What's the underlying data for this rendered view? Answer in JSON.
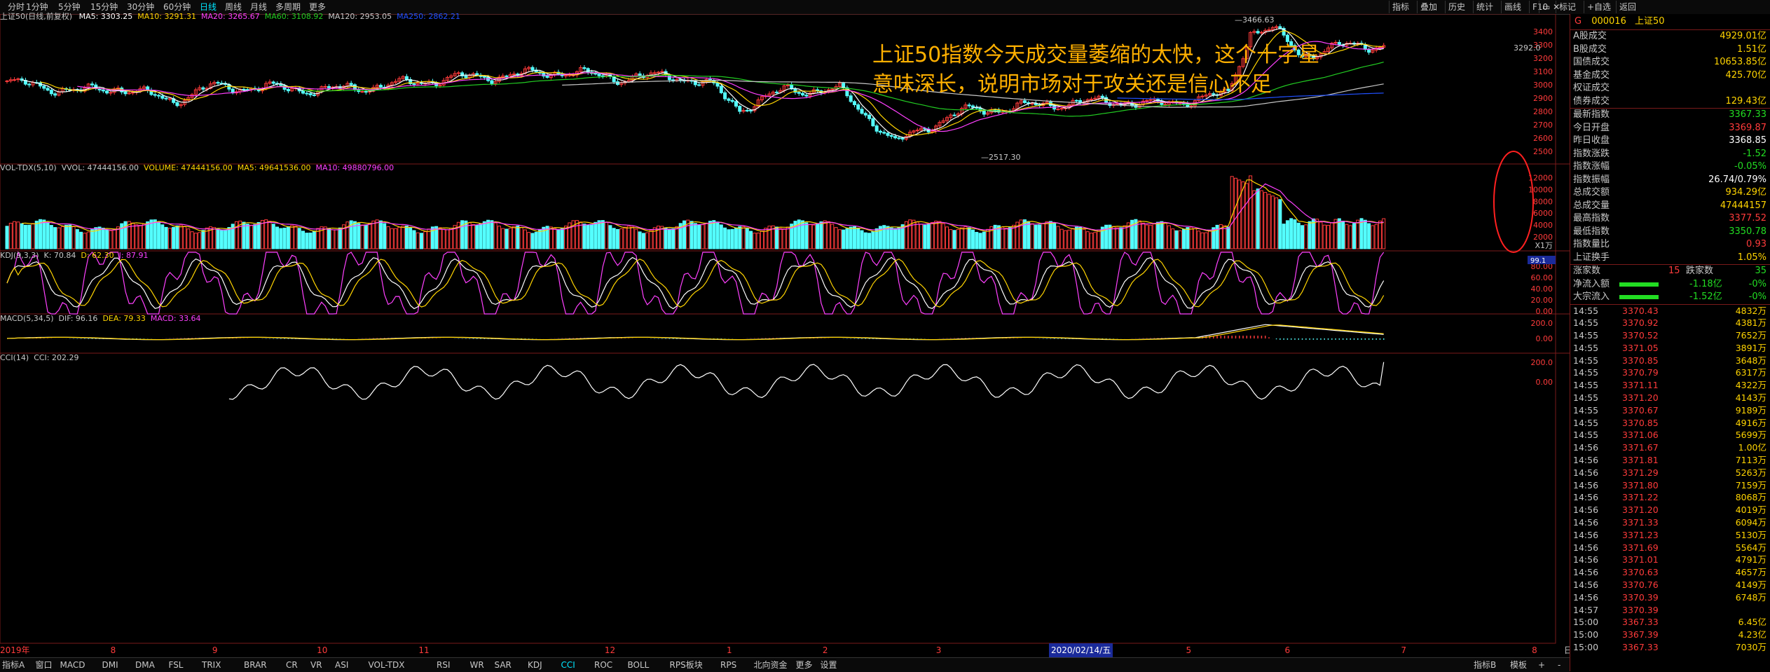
{
  "topbar": {
    "periods": [
      "分时",
      "1分钟",
      "5分钟",
      "15分钟",
      "30分钟",
      "60分钟",
      "日线",
      "周线",
      "月线",
      "多周期",
      "更多"
    ],
    "active_period": "日线",
    "tools": [
      "指标",
      "叠加",
      "历史",
      "统计",
      "画线",
      "F10",
      "标记",
      "+自选",
      "返回"
    ]
  },
  "main_panel": {
    "title": "上证50(日线,前复权)",
    "ma_labels": [
      {
        "text": "MA5: 3303.25",
        "color": "#ffffff"
      },
      {
        "text": "MA10: 3291.31",
        "color": "#ffd400"
      },
      {
        "text": "MA20: 3265.67",
        "color": "#ff40ff"
      },
      {
        "text": "MA60: 3108.92",
        "color": "#22cc22"
      },
      {
        "text": "MA120: 2953.05",
        "color": "#c8c8c8"
      },
      {
        "text": "MA250: 2862.21",
        "color": "#2050ff"
      }
    ],
    "y_ticks": [
      "3400",
      "3300",
      "3200",
      "3100",
      "3000",
      "2900",
      "2800",
      "2700",
      "2600",
      "2500"
    ],
    "high_label": "3466.63",
    "low_label": "2517.30",
    "last_label": "3292.0",
    "annotation_lines": [
      "上证50指数今天成交量萎缩的太快，这个十字星",
      "意味深长，说明市场对于攻关还是信心不足"
    ]
  },
  "volume_panel": {
    "labels": [
      {
        "text": "VOL-TDX(5,10)",
        "color": "#c8c8c8"
      },
      {
        "text": "VVOL: 47444156.00",
        "color": "#c8c8c8"
      },
      {
        "text": "VOLUME: 47444156.00",
        "color": "#ffd400"
      },
      {
        "text": "MA5: 49641536.00",
        "color": "#ffd400"
      },
      {
        "text": "MA10: 49880796.00",
        "color": "#ff40ff"
      }
    ],
    "y_ticks": [
      "12000",
      "10000",
      "8000",
      "6000",
      "4000",
      "2000"
    ],
    "unit": "X1万"
  },
  "kdj_panel": {
    "labels": [
      {
        "text": "KDJ(9,3,3)",
        "color": "#c8c8c8"
      },
      {
        "text": "K: 70.84",
        "color": "#c8c8c8"
      },
      {
        "text": "D: 62.30",
        "color": "#ffd400"
      },
      {
        "text": "J: 87.91",
        "color": "#ff40ff"
      }
    ],
    "y_ticks": [
      "80.00",
      "60.00",
      "40.00",
      "20.00",
      "0.00"
    ],
    "marker": "99.1"
  },
  "macd_panel": {
    "labels": [
      {
        "text": "MACD(5,34,5)",
        "color": "#c8c8c8"
      },
      {
        "text": "DIF: 96.16",
        "color": "#c8c8c8"
      },
      {
        "text": "DEA: 79.33",
        "color": "#ffd400"
      },
      {
        "text": "MACD: 33.64",
        "color": "#ff40ff"
      }
    ],
    "y_ticks": [
      "200.0",
      "0.00"
    ]
  },
  "cci_panel": {
    "labels": [
      {
        "text": "CCI(14)",
        "color": "#c8c8c8"
      },
      {
        "text": "CCI: 202.29",
        "color": "#c8c8c8"
      }
    ],
    "y_ticks": [
      "200.0",
      "0.00"
    ]
  },
  "date_axis": {
    "labels": [
      "2019年",
      "8",
      "9",
      "10",
      "11",
      "12",
      "1",
      "2",
      "3",
      "4",
      "5",
      "6",
      "7",
      "8"
    ],
    "highlight": "2020/02/14/五",
    "period_label": "日线"
  },
  "bottombar": {
    "tabs": [
      "指标A",
      "窗口",
      "MACD",
      "DMI",
      "DMA",
      "FSL",
      "TRIX",
      "BRAR",
      "CR",
      "VR",
      "ASI",
      "VOL-TDX",
      "RSI",
      "WR",
      "SAR",
      "KDJ",
      "CCI",
      "ROC",
      "BOLL",
      "RPS板块",
      "RPS",
      "北向资金",
      "更多",
      "设置"
    ],
    "active_tab": "CCI",
    "right_items": [
      "指标B",
      "模板",
      "+",
      "-"
    ]
  },
  "right_panel": {
    "code": "000016",
    "name": "上证50",
    "rows": [
      {
        "k": "A股成交",
        "v": "4929.01亿",
        "color": "#ffd400"
      },
      {
        "k": "B股成交",
        "v": "1.51亿",
        "color": "#ffd400"
      },
      {
        "k": "国债成交",
        "v": "10653.85亿",
        "color": "#ffd400"
      },
      {
        "k": "基金成交",
        "v": "425.70亿",
        "color": "#ffd400"
      },
      {
        "k": "权证成交",
        "v": "",
        "color": "#ffd400"
      },
      {
        "k": "债券成交",
        "v": "129.43亿",
        "color": "#ffd400"
      },
      {
        "k": "最新指数",
        "v": "3367.33",
        "color": "#22dd22"
      },
      {
        "k": "今日开盘",
        "v": "3369.87",
        "color": "#ff3b3b"
      },
      {
        "k": "昨日收盘",
        "v": "3368.85",
        "color": "#ffffff"
      },
      {
        "k": "指数涨跌",
        "v": "-1.52",
        "color": "#22dd22"
      },
      {
        "k": "指数涨幅",
        "v": "-0.05%",
        "color": "#22dd22"
      },
      {
        "k": "指数振幅",
        "v": "26.74/0.79%",
        "color": "#ffffff"
      },
      {
        "k": "总成交额",
        "v": "934.29亿",
        "color": "#ffd400"
      },
      {
        "k": "总成交量",
        "v": "47444157",
        "color": "#ffd400"
      },
      {
        "k": "最高指数",
        "v": "3377.52",
        "color": "#ff3b3b"
      },
      {
        "k": "最低指数",
        "v": "3350.78",
        "color": "#22dd22"
      },
      {
        "k": "指数量比",
        "v": "0.93",
        "color": "#ff3b3b"
      },
      {
        "k": "上证换手",
        "v": "1.05%",
        "color": "#ffd400"
      }
    ],
    "up_label": "涨家数",
    "up_count": "15",
    "down_label": "跌家数",
    "down_count": "35",
    "flows": [
      {
        "k": "净流入额",
        "v": "-1.18亿",
        "pct": "-0%"
      },
      {
        "k": "大宗流入",
        "v": "-1.52亿",
        "pct": "-0%"
      }
    ],
    "ticks": [
      {
        "t": "14:55",
        "p": "3370.43",
        "v": "4832万"
      },
      {
        "t": "14:55",
        "p": "3370.92",
        "v": "4381万"
      },
      {
        "t": "14:55",
        "p": "3370.52",
        "v": "7652万"
      },
      {
        "t": "14:55",
        "p": "3371.05",
        "v": "3891万"
      },
      {
        "t": "14:55",
        "p": "3370.85",
        "v": "3648万"
      },
      {
        "t": "14:55",
        "p": "3370.79",
        "v": "6317万"
      },
      {
        "t": "14:55",
        "p": "3371.11",
        "v": "4322万"
      },
      {
        "t": "14:55",
        "p": "3371.20",
        "v": "4143万"
      },
      {
        "t": "14:55",
        "p": "3370.67",
        "v": "9189万"
      },
      {
        "t": "14:55",
        "p": "3370.85",
        "v": "4916万"
      },
      {
        "t": "14:55",
        "p": "3371.06",
        "v": "5699万"
      },
      {
        "t": "14:56",
        "p": "3371.67",
        "v": "1.00亿"
      },
      {
        "t": "14:56",
        "p": "3371.81",
        "v": "7113万"
      },
      {
        "t": "14:56",
        "p": "3371.29",
        "v": "5263万"
      },
      {
        "t": "14:56",
        "p": "3371.80",
        "v": "7159万"
      },
      {
        "t": "14:56",
        "p": "3371.22",
        "v": "8068万"
      },
      {
        "t": "14:56",
        "p": "3371.20",
        "v": "4019万"
      },
      {
        "t": "14:56",
        "p": "3371.33",
        "v": "6094万"
      },
      {
        "t": "14:56",
        "p": "3371.23",
        "v": "5130万"
      },
      {
        "t": "14:56",
        "p": "3371.69",
        "v": "5564万"
      },
      {
        "t": "14:56",
        "p": "3371.01",
        "v": "4791万"
      },
      {
        "t": "14:56",
        "p": "3370.63",
        "v": "4657万"
      },
      {
        "t": "14:56",
        "p": "3370.76",
        "v": "4149万"
      },
      {
        "t": "14:56",
        "p": "3370.39",
        "v": "6748万"
      },
      {
        "t": "14:57",
        "p": "3370.39",
        "v": ""
      },
      {
        "t": "15:00",
        "p": "3367.33",
        "v": "6.45亿"
      },
      {
        "t": "15:00",
        "p": "3367.39",
        "v": "4.23亿"
      },
      {
        "t": "15:00",
        "p": "3367.33",
        "v": "7030万"
      }
    ]
  },
  "colors": {
    "up": "#ff3b3b",
    "down": "#54ffff",
    "grid": "#7a1a1a",
    "ma5": "#ffffff",
    "ma10": "#ffd400",
    "ma20": "#ff40ff",
    "ma60": "#22cc22",
    "ma250": "#2050ff",
    "annotation": "#ffb000"
  }
}
